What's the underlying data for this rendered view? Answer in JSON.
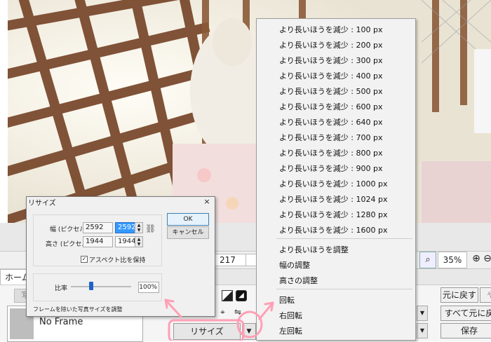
{
  "colors": {
    "accent_annotation": "#ff9fb5",
    "selection": "#3399ff",
    "menu_bg": "#f2f2f2"
  },
  "menu": {
    "items": [
      "より長いほうを減少 : 100 px",
      "より長いほうを減少 : 200 px",
      "より長いほうを減少 : 300 px",
      "より長いほうを減少 : 400 px",
      "より長いほうを減少 : 500 px",
      "より長いほうを減少 : 600 px",
      "より長いほうを減少 : 640 px",
      "より長いほうを減少 : 700 px",
      "より長いほうを減少 : 800 px",
      "より長いほうを減少 : 900 px",
      "より長いほうを減少 : 1000 px",
      "より長いほうを減少 : 1024 px",
      "より長いほうを減少 : 1280 px",
      "より長いほうを減少 : 1600 px"
    ],
    "adjust_items": [
      "より長いほうを調整",
      "幅の調整",
      "高さの調整"
    ],
    "rotate_items": [
      "回転",
      "右回転",
      "左回転"
    ]
  },
  "dialog": {
    "title": "リサイズ",
    "close": "×",
    "width_label": "幅 (ピクセル)",
    "height_label": "高さ (ピクセル)",
    "width_original": "2592",
    "width_value": "2592",
    "height_original": "1944",
    "height_value": "1944",
    "aspect_label": "アスペクト比を保持",
    "aspect_checked": "✓",
    "ratio_label": "比率",
    "ratio_value": "100%",
    "ok": "OK",
    "cancel": "キャンセル",
    "note": "フレームを除いた写真サイズを調整"
  },
  "status": {
    "value": "217",
    "zoom": "35%"
  },
  "tabs": {
    "home": "ホーム"
  },
  "ribbon": {
    "ghost_label": "写",
    "frame_name": "No Frame",
    "resize_label": "リサイズ",
    "resize_arrow": "▼",
    "undo": "元に戻す",
    "redo": "や",
    "undo_all": "すべて元に戻",
    "save": "保存",
    "dropdown_arrow": "▼"
  },
  "icons": {
    "zoom_fit": "zoom-fit-icon",
    "zoom_in": "zoom-in-icon",
    "zoom_out": "zoom-out-icon",
    "chain": "chain-link-icon"
  }
}
